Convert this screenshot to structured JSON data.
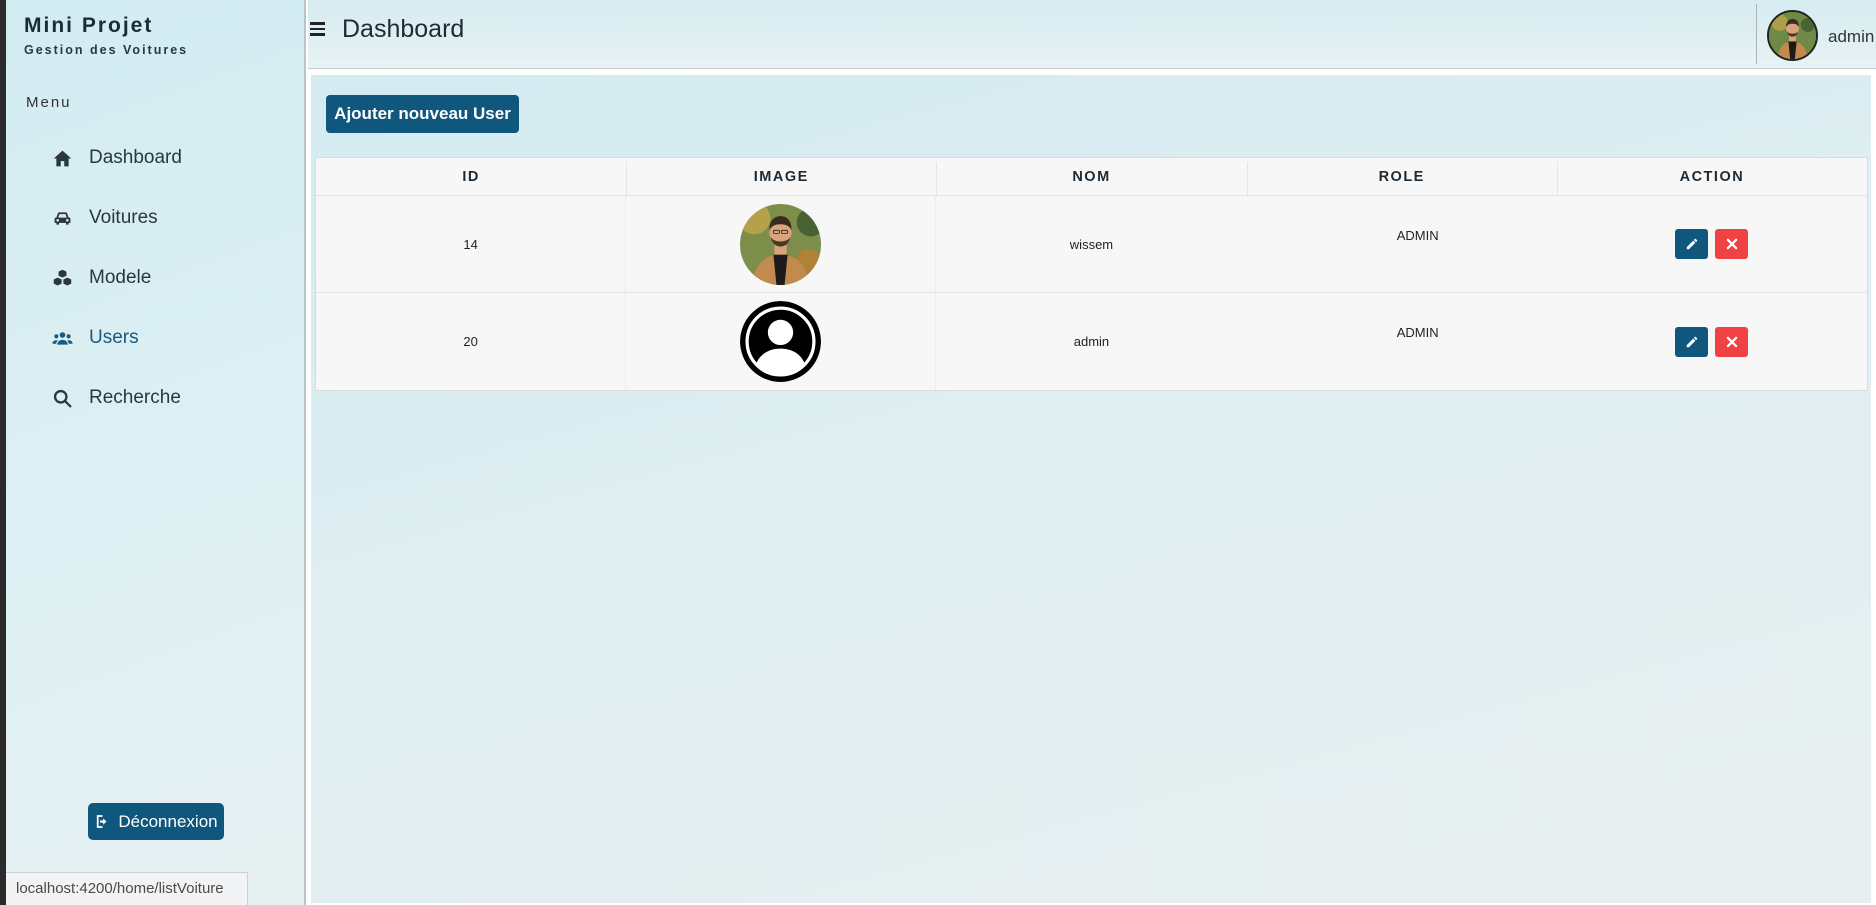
{
  "brand": {
    "title": "Mini Projet",
    "subtitle": "Gestion des Voitures"
  },
  "sidebar": {
    "menu_title": "Menu",
    "items": [
      {
        "label": "Dashboard",
        "icon": "home-icon"
      },
      {
        "label": "Voitures",
        "icon": "car-icon"
      },
      {
        "label": "Modele",
        "icon": "cubes-icon"
      },
      {
        "label": "Users",
        "icon": "users-icon"
      },
      {
        "label": "Recherche",
        "icon": "search-icon"
      }
    ],
    "logout_label": "Déconnexion"
  },
  "status_bar": {
    "url": "localhost:4200/home/listVoiture"
  },
  "header": {
    "title": "Dashboard",
    "user_name": "admin"
  },
  "main": {
    "add_button_label": "Ajouter nouveau User",
    "table": {
      "columns": [
        "ID",
        "IMAGE",
        "NOM",
        "ROLE",
        "ACTION"
      ],
      "rows": [
        {
          "id": "14",
          "image": "user-photo",
          "nom": "wissem",
          "role": "ADMIN"
        },
        {
          "id": "20",
          "image": "default-user-avatar",
          "nom": "admin",
          "role": "ADMIN"
        }
      ]
    }
  },
  "colors": {
    "primary": "#10577e",
    "danger": "#f04242",
    "sidebar_bg": "#d2ecf2",
    "content_bg": "#dfeef1"
  }
}
